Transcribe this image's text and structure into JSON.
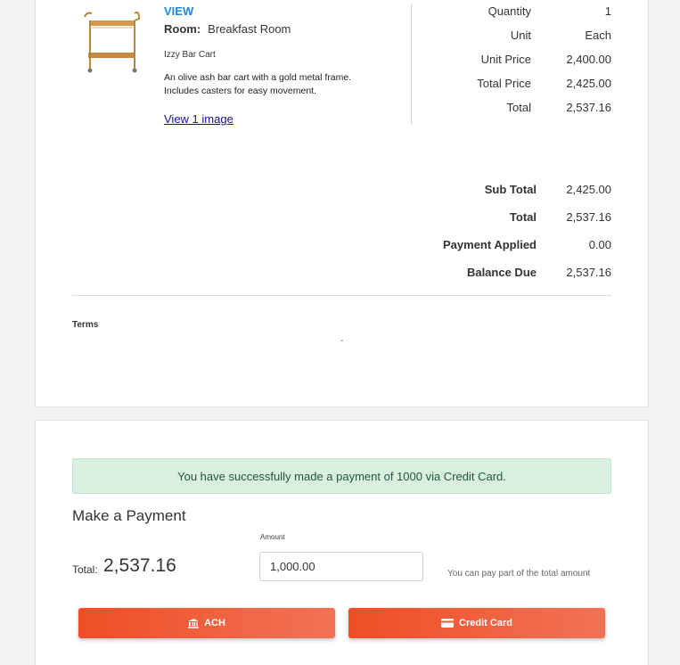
{
  "item": {
    "view_label": "VIEW",
    "room_label": "Room:",
    "room_value": "Breakfast Room",
    "name": "Izzy Bar Cart",
    "description": "An olive ash bar cart with a gold metal frame. Includes casters for easy movement.",
    "view_images_label": "View 1 image"
  },
  "pricing": [
    {
      "label": "Quantity",
      "value": "1"
    },
    {
      "label": "Unit",
      "value": "Each"
    },
    {
      "label": "Unit Price",
      "value": "2,400.00"
    },
    {
      "label": "Total Price",
      "value": "2,425.00"
    },
    {
      "label": "Total",
      "value": "2,537.16"
    }
  ],
  "totals": [
    {
      "label": "Sub Total",
      "value": "2,425.00"
    },
    {
      "label": "Total",
      "value": "2,537.16"
    },
    {
      "label": "Payment Applied",
      "value": "0.00"
    },
    {
      "label": "Balance Due",
      "value": "2,537.16"
    }
  ],
  "terms": {
    "label": "Terms",
    "value": "-"
  },
  "payment": {
    "success_message": "You have successfully made a payment of 1000 via Credit Card.",
    "title": "Make a Payment",
    "total_label": "Total:",
    "total_value": "2,537.16",
    "amount_label": "Amount",
    "amount_value": "1,000.00",
    "hint": "You can pay part of the total amount",
    "ach_label": "ACH",
    "credit_card_label": "Credit Card"
  },
  "colors": {
    "accent": "#1e88e5",
    "button_start": "#ee4e26",
    "button_end": "#f27255",
    "success_bg": "#d9efe0"
  },
  "icons": [
    "bar-cart-image",
    "bank-icon",
    "credit-card-icon"
  ]
}
